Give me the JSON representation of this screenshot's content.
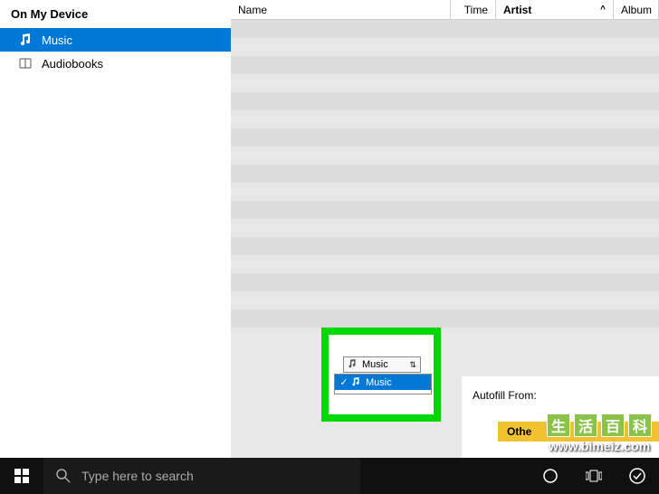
{
  "sidebar": {
    "header": "On My Device",
    "items": [
      {
        "label": "Music",
        "icon": "music",
        "selected": true
      },
      {
        "label": "Audiobooks",
        "icon": "book",
        "selected": false
      }
    ]
  },
  "table": {
    "columns": {
      "name": "Name",
      "time": "Time",
      "artist": "Artist",
      "album": "Album"
    },
    "sort_indicator": "^"
  },
  "autofill": {
    "label": "Autofill From:",
    "selected": "Music",
    "options": [
      "Music"
    ]
  },
  "other_label": "Othe",
  "taskbar": {
    "search_placeholder": "Type here to search"
  },
  "watermark": {
    "chars": [
      "生",
      "活",
      "百",
      "科"
    ],
    "url": "www.bimeiz.com"
  }
}
